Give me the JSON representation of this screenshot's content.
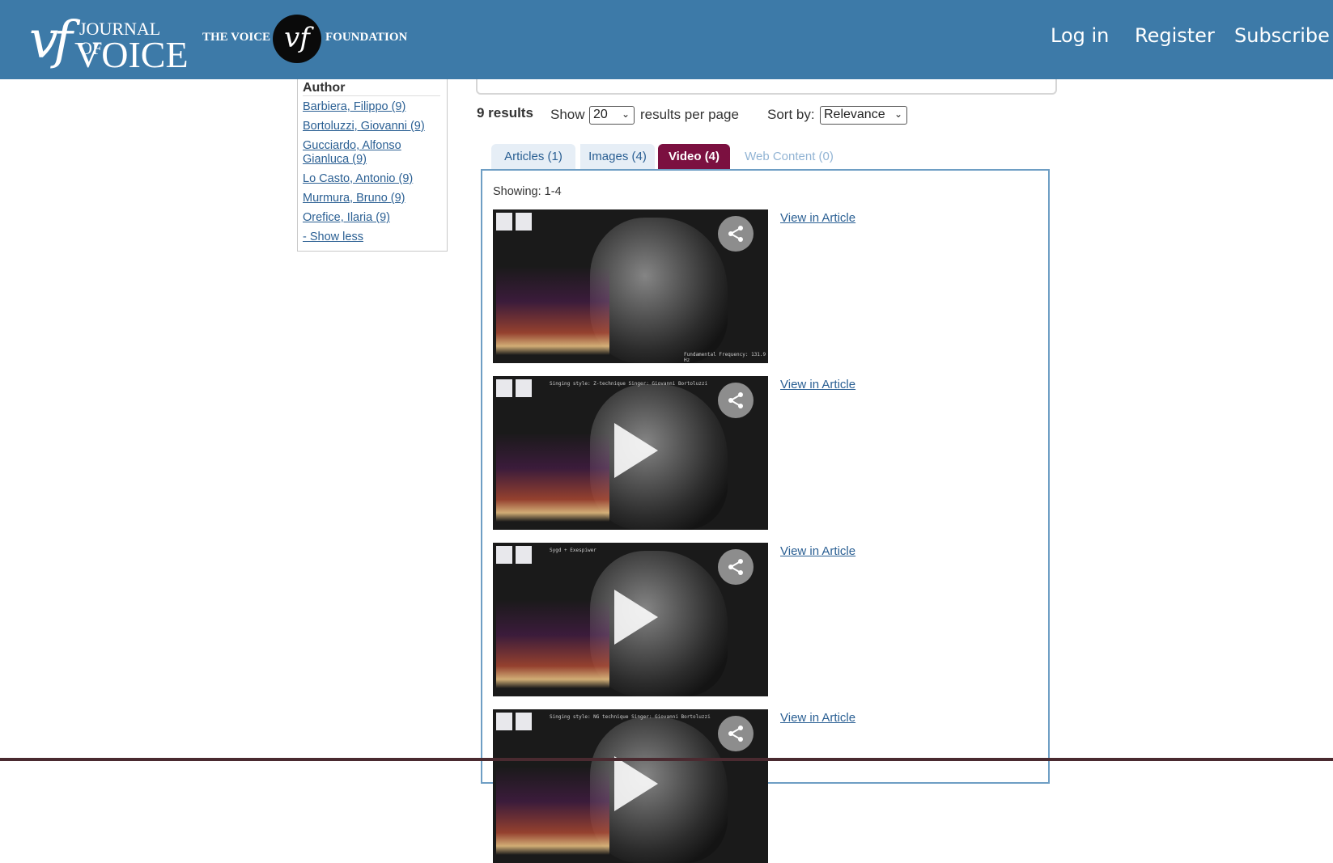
{
  "header": {
    "journal_logo": {
      "vf": "vf",
      "journal_of": "JOURNAL OF",
      "voice": "VOICE"
    },
    "foundation_logo": {
      "left": "THE VOICE",
      "mark": "vf",
      "right": "FOUNDATION"
    },
    "nav": {
      "login": "Log in",
      "register": "Register",
      "subscribe": "Subscribe"
    },
    "background_color": "#3d7aa8"
  },
  "sidebar": {
    "author_facet": {
      "title": "Author",
      "items": [
        {
          "label": "Barbiera, Filippo (9)"
        },
        {
          "label": "Bortoluzzi, Giovanni (9)"
        },
        {
          "label": "Gucciardo, Alfonso Gianluca (9)"
        },
        {
          "label": "Lo Casto, Antonio (9)"
        },
        {
          "label": "Murmura, Bruno (9)"
        },
        {
          "label": "Orefice, Ilaria (9)"
        }
      ],
      "show_less": "- Show less"
    }
  },
  "results_bar": {
    "count": "9 results",
    "show_label": "Show",
    "per_page_value": "20",
    "per_page_label": "results per page",
    "sort_label": "Sort by:",
    "sort_value": "Relevance"
  },
  "tabs": [
    {
      "label": "Articles (1)",
      "active": false
    },
    {
      "label": "Images (4)",
      "active": false
    },
    {
      "label": "Video (4)",
      "active": true
    },
    {
      "label": "Web Content (0)",
      "active": false
    }
  ],
  "active_tab_color": "#7b1040",
  "panel": {
    "showing": "Showing: 1-4",
    "videos": [
      {
        "view_link": "View in Article",
        "has_play": false,
        "thumb_caption": "Fundamental Frequency: 131.9 Hz"
      },
      {
        "view_link": "View in Article",
        "has_play": true,
        "thumb_caption": "Singing style: Z-technique Singer: Giovanni Bortoluzzi"
      },
      {
        "view_link": "View in Article",
        "has_play": true,
        "thumb_caption": "Sygd + Exespiwer"
      },
      {
        "view_link": "View in Article",
        "has_play": true,
        "thumb_caption": "Singing style: NG technique Singer: Giovanni Bortoluzzi"
      }
    ]
  },
  "icons": {
    "share": "share-icon",
    "play": "play-icon",
    "dropdown": "chevron-down-icon"
  }
}
